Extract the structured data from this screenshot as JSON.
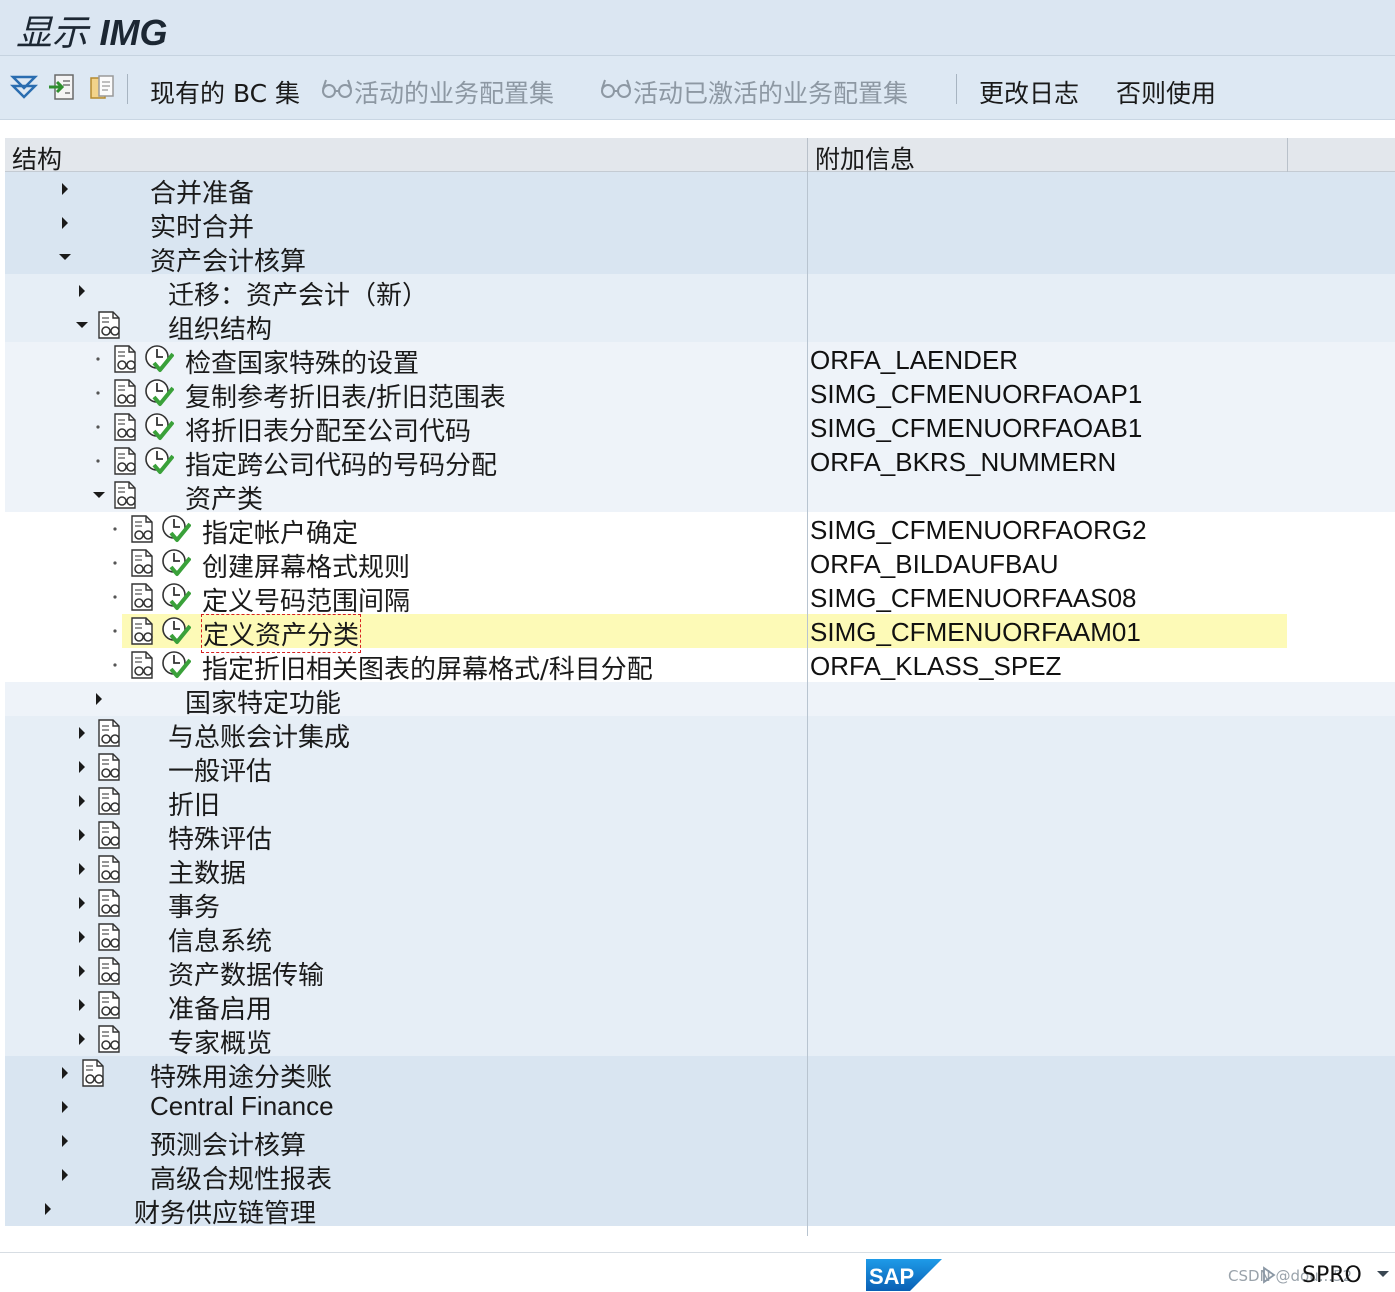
{
  "window": {
    "title_prefix": "显示",
    "title_bold": "IMG"
  },
  "toolbar": {
    "existing_bc": "现有的 BC 集",
    "active_bc": "活动的业务配置集",
    "activated_bc": "活动已激活的业务配置集",
    "change_log": "更改日志",
    "where_used": "否则使用"
  },
  "tree": {
    "headers": {
      "structure": "结构",
      "info": "附加信息"
    },
    "rows": [
      {
        "label": "合并准备",
        "info": "",
        "level": 0,
        "state": "collapsed"
      },
      {
        "label": "实时合并",
        "info": "",
        "level": 0,
        "state": "collapsed"
      },
      {
        "label": "资产会计核算",
        "info": "",
        "level": 0,
        "state": "expanded"
      },
      {
        "label": "迁移：资产会计（新）",
        "info": "",
        "level": 1,
        "state": "collapsed"
      },
      {
        "label": "组织结构",
        "info": "",
        "level": 1,
        "state": "expanded",
        "doc": true
      },
      {
        "label": "检查国家特殊的设置",
        "info": "ORFA_LAENDER",
        "level": 2,
        "state": "leaf",
        "doc": true,
        "exec": true
      },
      {
        "label": "复制参考折旧表/折旧范围表",
        "info": "SIMG_CFMENUORFAOAP1",
        "level": 2,
        "state": "leaf",
        "doc": true,
        "exec": true
      },
      {
        "label": "将折旧表分配至公司代码",
        "info": "SIMG_CFMENUORFAOAB1",
        "level": 2,
        "state": "leaf",
        "doc": true,
        "exec": true
      },
      {
        "label": "指定跨公司代码的号码分配",
        "info": "ORFA_BKRS_NUMMERN",
        "level": 2,
        "state": "leaf",
        "doc": true,
        "exec": true
      },
      {
        "label": "资产类",
        "info": "",
        "level": 2,
        "state": "expanded",
        "doc": true
      },
      {
        "label": "指定帐户确定",
        "info": "SIMG_CFMENUORFAORG2",
        "level": 3,
        "state": "leaf",
        "doc": true,
        "exec": true
      },
      {
        "label": "创建屏幕格式规则",
        "info": "ORFA_BILDAUFBAU",
        "level": 3,
        "state": "leaf",
        "doc": true,
        "exec": true
      },
      {
        "label": "定义号码范围间隔",
        "info": "SIMG_CFMENUORFAAS08",
        "level": 3,
        "state": "leaf",
        "doc": true,
        "exec": true
      },
      {
        "label": "定义资产分类",
        "info": "SIMG_CFMENUORFAAM01",
        "level": 3,
        "state": "leaf",
        "doc": true,
        "exec": true,
        "selected": true
      },
      {
        "label": "指定折旧相关图表的屏幕格式/科目分配",
        "info": "ORFA_KLASS_SPEZ",
        "level": 3,
        "state": "leaf",
        "doc": true,
        "exec": true
      },
      {
        "label": "国家特定功能",
        "info": "",
        "level": 2,
        "state": "collapsed"
      },
      {
        "label": "与总账会计集成",
        "info": "",
        "level": 1,
        "state": "collapsed",
        "doc": true
      },
      {
        "label": "一般评估",
        "info": "",
        "level": 1,
        "state": "collapsed",
        "doc": true
      },
      {
        "label": "折旧",
        "info": "",
        "level": 1,
        "state": "collapsed",
        "doc": true
      },
      {
        "label": "特殊评估",
        "info": "",
        "level": 1,
        "state": "collapsed",
        "doc": true
      },
      {
        "label": "主数据",
        "info": "",
        "level": 1,
        "state": "collapsed",
        "doc": true
      },
      {
        "label": "事务",
        "info": "",
        "level": 1,
        "state": "collapsed",
        "doc": true
      },
      {
        "label": "信息系统",
        "info": "",
        "level": 1,
        "state": "collapsed",
        "doc": true
      },
      {
        "label": "资产数据传输",
        "info": "",
        "level": 1,
        "state": "collapsed",
        "doc": true
      },
      {
        "label": "准备启用",
        "info": "",
        "level": 1,
        "state": "collapsed",
        "doc": true
      },
      {
        "label": "专家概览",
        "info": "",
        "level": 1,
        "state": "collapsed",
        "doc": true
      },
      {
        "label": "特殊用途分类账",
        "info": "",
        "level": 0,
        "state": "collapsed",
        "doc": true
      },
      {
        "label": "Central Finance",
        "info": "",
        "level": 0,
        "state": "collapsed"
      },
      {
        "label": "预测会计核算",
        "info": "",
        "level": 0,
        "state": "collapsed"
      },
      {
        "label": "高级合规性报表",
        "info": "",
        "level": 0,
        "state": "collapsed"
      },
      {
        "label": "财务供应链管理",
        "info": "",
        "level": -1,
        "state": "collapsed"
      }
    ]
  },
  "status_bar": {
    "transaction": "SPRO",
    "watermark": "CSDN @dou...52",
    "logo_text": "SAP"
  },
  "colors": {
    "band_level0": "#d9e5f1",
    "band_level1": "#e6eef6",
    "band_level2": "#eef3f9",
    "band_level3": "#ffffff",
    "highlight": "#fdfab7",
    "exec_check": "#3aa13a"
  }
}
